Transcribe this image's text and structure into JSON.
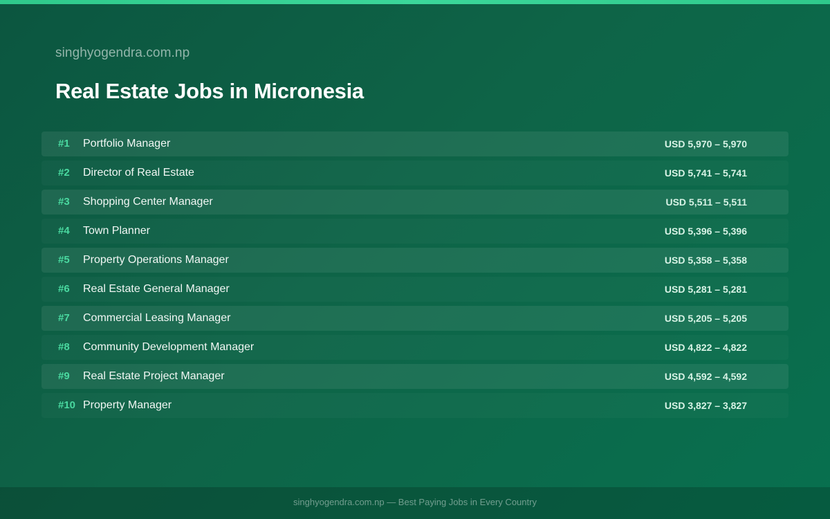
{
  "site": {
    "name": "singhyogendra.com.np"
  },
  "page": {
    "title": "Real Estate Jobs in Micronesia"
  },
  "colors": {
    "accent": "#4ad9a0",
    "top_bar": "#2fc98b",
    "background": "#0e6447"
  },
  "jobs": [
    {
      "rank": "#1",
      "title": "Portfolio Manager",
      "salary": "USD 5,970 – 5,970"
    },
    {
      "rank": "#2",
      "title": "Director of Real Estate",
      "salary": "USD 5,741 – 5,741"
    },
    {
      "rank": "#3",
      "title": "Shopping Center Manager",
      "salary": "USD 5,511 – 5,511"
    },
    {
      "rank": "#4",
      "title": "Town Planner",
      "salary": "USD 5,396 – 5,396"
    },
    {
      "rank": "#5",
      "title": "Property Operations Manager",
      "salary": "USD 5,358 – 5,358"
    },
    {
      "rank": "#6",
      "title": "Real Estate General Manager",
      "salary": "USD 5,281 – 5,281"
    },
    {
      "rank": "#7",
      "title": "Commercial Leasing Manager",
      "salary": "USD 5,205 – 5,205"
    },
    {
      "rank": "#8",
      "title": "Community Development Manager",
      "salary": "USD 4,822 – 4,822"
    },
    {
      "rank": "#9",
      "title": "Real Estate Project Manager",
      "salary": "USD 4,592 – 4,592"
    },
    {
      "rank": "#10",
      "title": "Property Manager",
      "salary": "USD 3,827 – 3,827"
    }
  ],
  "footer": {
    "text": "singhyogendra.com.np — Best Paying Jobs in Every Country"
  }
}
